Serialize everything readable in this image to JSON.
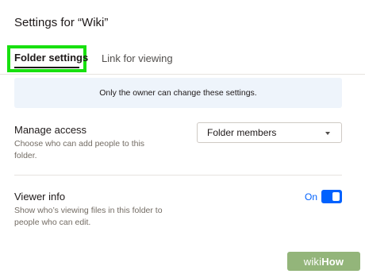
{
  "dialog": {
    "title": "Settings for “Wiki”"
  },
  "tabs": [
    {
      "label": "Folder settings",
      "active": true
    },
    {
      "label": "Link for viewing",
      "active": false
    }
  ],
  "notice": "Only the owner can change these settings.",
  "manage_access": {
    "title": "Manage access",
    "description": "Choose who can add people to this folder.",
    "select_value": "Folder members"
  },
  "viewer_info": {
    "title": "Viewer info",
    "description": "Show who’s viewing files in this folder to people who can edit.",
    "toggle_label": "On",
    "toggle_on": true
  },
  "watermark": {
    "wiki": "wiki",
    "how": "How"
  },
  "colors": {
    "accent": "#0061fe",
    "highlight": "#18e00f",
    "notice_bg": "#eef4fb"
  }
}
